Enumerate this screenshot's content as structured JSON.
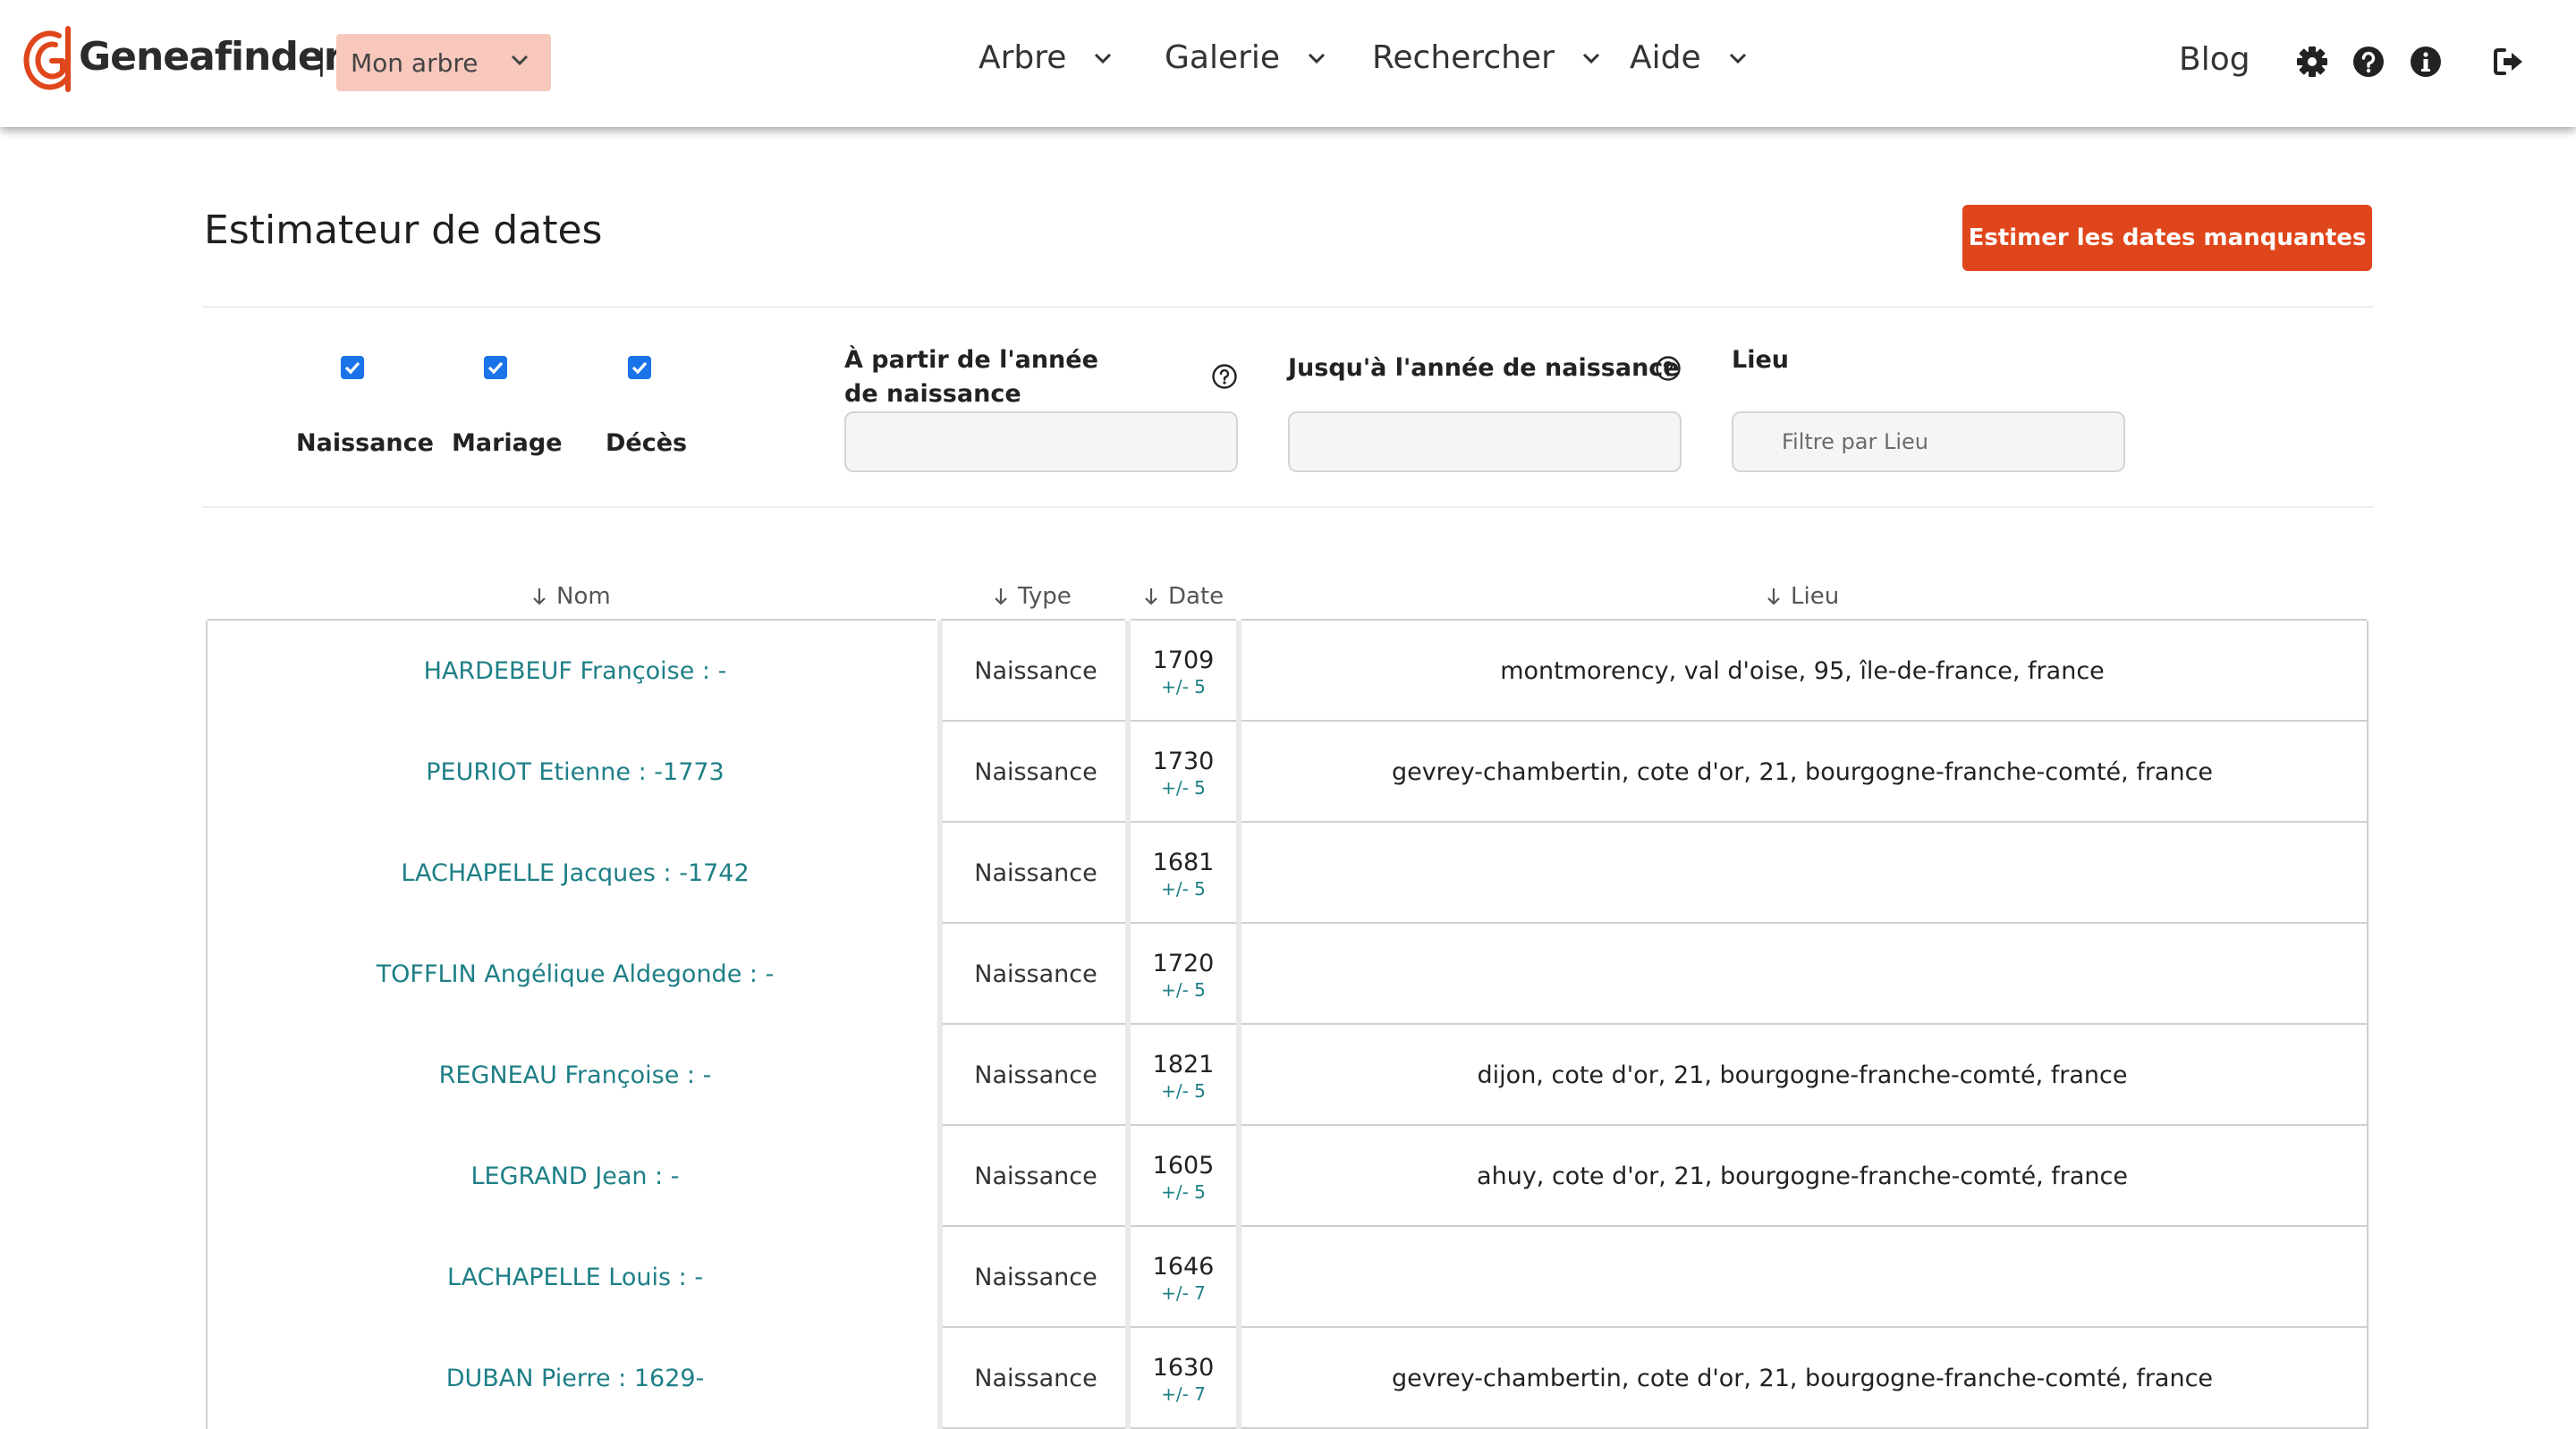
{
  "header": {
    "logo_text": "Geneafinder",
    "separator": "|",
    "tree_select": "Mon arbre",
    "nav": [
      {
        "label": "Arbre"
      },
      {
        "label": "Galerie"
      },
      {
        "label": "Rechercher"
      },
      {
        "label": "Aide"
      }
    ],
    "blog": "Blog"
  },
  "page": {
    "title": "Estimateur de dates",
    "estimate_button": "Estimer les dates manquantes"
  },
  "filters": {
    "checkboxes": [
      {
        "label": "Naissance",
        "checked": true
      },
      {
        "label": "Mariage",
        "checked": true
      },
      {
        "label": "Décès",
        "checked": true
      }
    ],
    "from_year_label": "À partir de l'année de naissance",
    "to_year_label": "Jusqu'à l'année de naissance",
    "place_label": "Lieu",
    "place_placeholder": "Filtre par Lieu"
  },
  "table": {
    "columns": [
      "Nom",
      "Type",
      "Date",
      "Lieu"
    ],
    "rows": [
      {
        "name": "HARDEBEUF Françoise : -",
        "type": "Naissance",
        "year": "1709",
        "margin": "+/- 5",
        "place": "montmorency, val d'oise, 95, île-de-france, france"
      },
      {
        "name": "PEURIOT Etienne : -1773",
        "type": "Naissance",
        "year": "1730",
        "margin": "+/- 5",
        "place": "gevrey-chambertin, cote d'or, 21, bourgogne-franche-comté, france"
      },
      {
        "name": "LACHAPELLE Jacques : -1742",
        "type": "Naissance",
        "year": "1681",
        "margin": "+/- 5",
        "place": ""
      },
      {
        "name": "TOFFLIN Angélique Aldegonde : -",
        "type": "Naissance",
        "year": "1720",
        "margin": "+/- 5",
        "place": ""
      },
      {
        "name": "REGNEAU Françoise : -",
        "type": "Naissance",
        "year": "1821",
        "margin": "+/- 5",
        "place": "dijon, cote d'or, 21, bourgogne-franche-comté, france"
      },
      {
        "name": "LEGRAND Jean : -",
        "type": "Naissance",
        "year": "1605",
        "margin": "+/- 5",
        "place": "ahuy, cote d'or, 21, bourgogne-franche-comté, france"
      },
      {
        "name": "LACHAPELLE Louis : -",
        "type": "Naissance",
        "year": "1646",
        "margin": "+/- 7",
        "place": ""
      },
      {
        "name": "DUBAN Pierre : 1629-",
        "type": "Naissance",
        "year": "1630",
        "margin": "+/- 7",
        "place": "gevrey-chambertin, cote d'or, 21, bourgogne-franche-comté, france"
      }
    ]
  },
  "colors": {
    "brand": "#e0461b",
    "tree_select_bg": "#f8c8bd",
    "link": "#1e7f86",
    "checkbox": "#1a73e8"
  },
  "icons": [
    "logo-icon",
    "chevron-down-icon",
    "gear-icon",
    "help-icon",
    "info-icon",
    "logout-icon",
    "question-icon",
    "sort-arrow-icon"
  ]
}
